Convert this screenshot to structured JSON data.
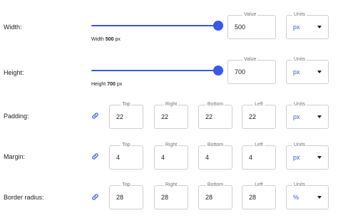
{
  "width": {
    "label": "Width:",
    "value_legend": "Value",
    "value": "500",
    "units_legend": "Units",
    "unit": "px",
    "hint_prefix": "Width",
    "hint_value": "500",
    "hint_unit": "px",
    "slider_fraction": 1.0
  },
  "height": {
    "label": "Height:",
    "value_legend": "Value",
    "value": "700",
    "units_legend": "Units",
    "unit": "px",
    "hint_prefix": "Height",
    "hint_value": "700",
    "hint_unit": "px",
    "slider_fraction": 1.0
  },
  "padding": {
    "label": "Padding:",
    "top_legend": "Top",
    "top": "22",
    "right_legend": "Right",
    "right": "22",
    "bottom_legend": "Bottom",
    "bottom": "22",
    "left_legend": "Left",
    "left": "22",
    "units_legend": "Units",
    "unit": "px"
  },
  "margin": {
    "label": "Margin:",
    "top_legend": "Top",
    "top": "4",
    "right_legend": "Right",
    "right": "4",
    "bottom_legend": "Bottom",
    "bottom": "4",
    "left_legend": "Left",
    "left": "4",
    "units_legend": "Units",
    "unit": "px"
  },
  "border_radius": {
    "label": "Border radius:",
    "top_legend": "Top",
    "top": "28",
    "right_legend": "Right",
    "right": "28",
    "bottom_legend": "Bottom",
    "bottom": "28",
    "left_legend": "Left",
    "left": "28",
    "units_legend": "Units",
    "unit": "%"
  },
  "colors": {
    "accent": "#3858e9",
    "border": "#cfcfcf",
    "legend": "#757575"
  },
  "icons": {
    "link": "link-icon",
    "dropdown": "chevron-down-icon"
  }
}
